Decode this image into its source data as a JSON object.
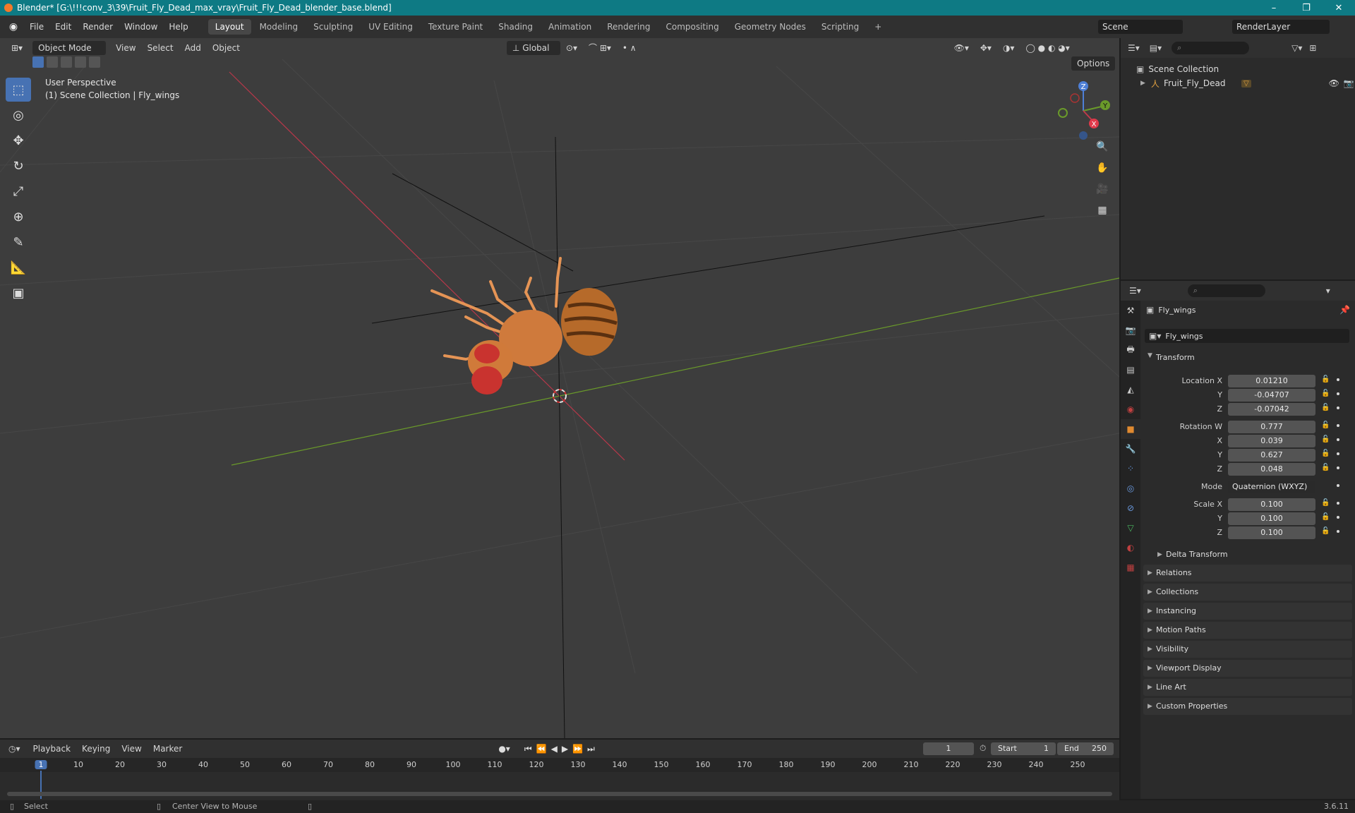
{
  "window": {
    "title": "Blender* [G:\\!!!conv_3\\39\\Fruit_Fly_Dead_max_vray\\Fruit_Fly_Dead_blender_base.blend]",
    "minimize": "–",
    "maximize": "❐",
    "close": "✕"
  },
  "menu": [
    "File",
    "Edit",
    "Render",
    "Window",
    "Help"
  ],
  "workspaces": [
    "Layout",
    "Modeling",
    "Sculpting",
    "UV Editing",
    "Texture Paint",
    "Shading",
    "Animation",
    "Rendering",
    "Compositing",
    "Geometry Nodes",
    "Scripting",
    "+"
  ],
  "active_workspace": "Layout",
  "scene": {
    "name": "Scene",
    "view_layer": "RenderLayer"
  },
  "viewport": {
    "mode": "Object Mode",
    "menus": [
      "View",
      "Select",
      "Add",
      "Object"
    ],
    "transform_orientation": "Global",
    "options_label": "Options",
    "view_name": "User Perspective",
    "collection_info": "(1) Scene Collection | Fly_wings",
    "gizmo_axes": {
      "x": "X",
      "y": "Y",
      "z": "Z"
    }
  },
  "outliner": {
    "root": "Scene Collection",
    "items": [
      {
        "name": "Fruit_Fly_Dead"
      }
    ]
  },
  "properties": {
    "object_name": "Fly_wings",
    "data_name": "Fly_wings",
    "transform_title": "Transform",
    "location": {
      "label_x": "Location X",
      "label_y": "Y",
      "label_z": "Z",
      "x": "0.01210",
      "y": "-0.04707",
      "z": "-0.07042"
    },
    "rotation": {
      "label_w": "Rotation W",
      "label_x": "X",
      "label_y": "Y",
      "label_z": "Z",
      "w": "0.777",
      "x": "0.039",
      "y": "0.627",
      "z": "0.048"
    },
    "mode_label": "Mode",
    "mode_value": "Quaternion (WXYZ)",
    "scale": {
      "label_x": "Scale X",
      "label_y": "Y",
      "label_z": "Z",
      "x": "0.100",
      "y": "0.100",
      "z": "0.100"
    },
    "delta_transform": "Delta Transform",
    "panels": [
      "Relations",
      "Collections",
      "Instancing",
      "Motion Paths",
      "Visibility",
      "Viewport Display",
      "Line Art",
      "Custom Properties"
    ]
  },
  "timeline": {
    "menus": [
      "Playback",
      "Keying",
      "View",
      "Marker"
    ],
    "current_frame": "1",
    "start_label": "Start",
    "start": "1",
    "end_label": "End",
    "end": "250",
    "ticks": [
      "1",
      "10",
      "20",
      "30",
      "40",
      "50",
      "60",
      "70",
      "80",
      "90",
      "100",
      "110",
      "120",
      "130",
      "140",
      "150",
      "160",
      "170",
      "180",
      "190",
      "200",
      "210",
      "220",
      "230",
      "240",
      "250"
    ]
  },
  "status": {
    "left": "Select",
    "middle": "Center View to Mouse",
    "version": "3.6.11"
  },
  "colors": {
    "titlebar": "#0e7a84",
    "accent": "#4772b3",
    "axis_x": "#c0394a",
    "axis_y": "#6a9a2a",
    "fly_body": "#d07a3a"
  }
}
